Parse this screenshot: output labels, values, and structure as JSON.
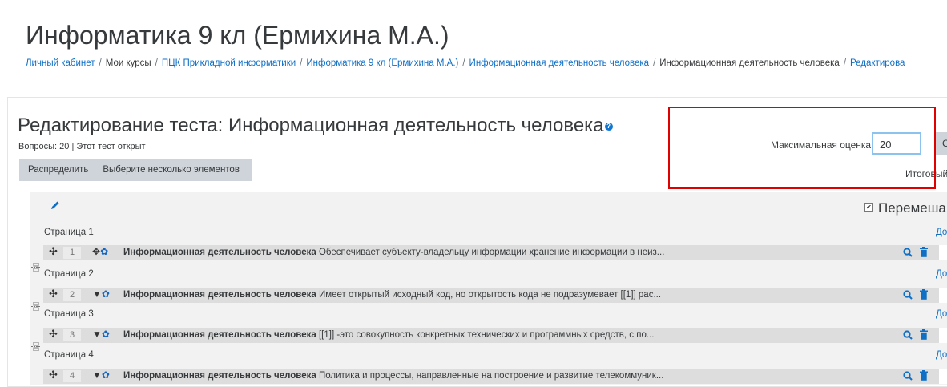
{
  "course": {
    "title": "Информатика 9 кл (Ермихина М.А.)"
  },
  "breadcrumb": [
    {
      "label": "Личный кабинет",
      "link": true
    },
    {
      "label": "Мои курсы",
      "link": false
    },
    {
      "label": "ПЦК Прикладной информатики",
      "link": true
    },
    {
      "label": "Информатика 9 кл (Ермихина М.А.)",
      "link": true
    },
    {
      "label": "Информационная деятельность человека",
      "link": true
    },
    {
      "label": "Информационная деятельность человека",
      "link": false
    },
    {
      "label": "Редактирова",
      "link": true
    }
  ],
  "edit": {
    "title": "Редактирование теста: Информационная деятельность человека",
    "status": "Вопросы: 20 | Этот тест открыт",
    "actions": [
      "Распределить",
      "Выберите несколько элементов"
    ]
  },
  "grade": {
    "max_label": "Максимальная оценка",
    "max_value": "20",
    "save_label": "С",
    "total_label": "Итоговый"
  },
  "shuffle_label": "Перемеша",
  "add_label": "До",
  "pages": [
    {
      "page_label": "Страница 1",
      "number": "1",
      "icon": "move",
      "question_name": "Информационная деятельность человека",
      "question_text": "Обеспечивает субъекту-владельцу информации хранение информации в неиз..."
    },
    {
      "page_label": "Страница 2",
      "number": "2",
      "icon": "arrow",
      "question_name": "Информационная деятельность человека",
      "question_text": "Имеет открытый исходный код, но открытость кода не подразумевает [[1]] рас..."
    },
    {
      "page_label": "Страница 3",
      "number": "3",
      "icon": "arrow",
      "question_name": "Информационная деятельность человека",
      "question_text": "[[1]]  -это совокупность конкретных технических и программных средств, с по..."
    },
    {
      "page_label": "Страница 4",
      "number": "4",
      "icon": "arrow",
      "question_name": "Информационная деятельность человека",
      "question_text": "Политика и процессы, направленные на построение и развитие телекоммуник..."
    }
  ],
  "colors": {
    "link": "#0f6fc5",
    "highlight": "#e00000",
    "gear": "#1466c1"
  }
}
